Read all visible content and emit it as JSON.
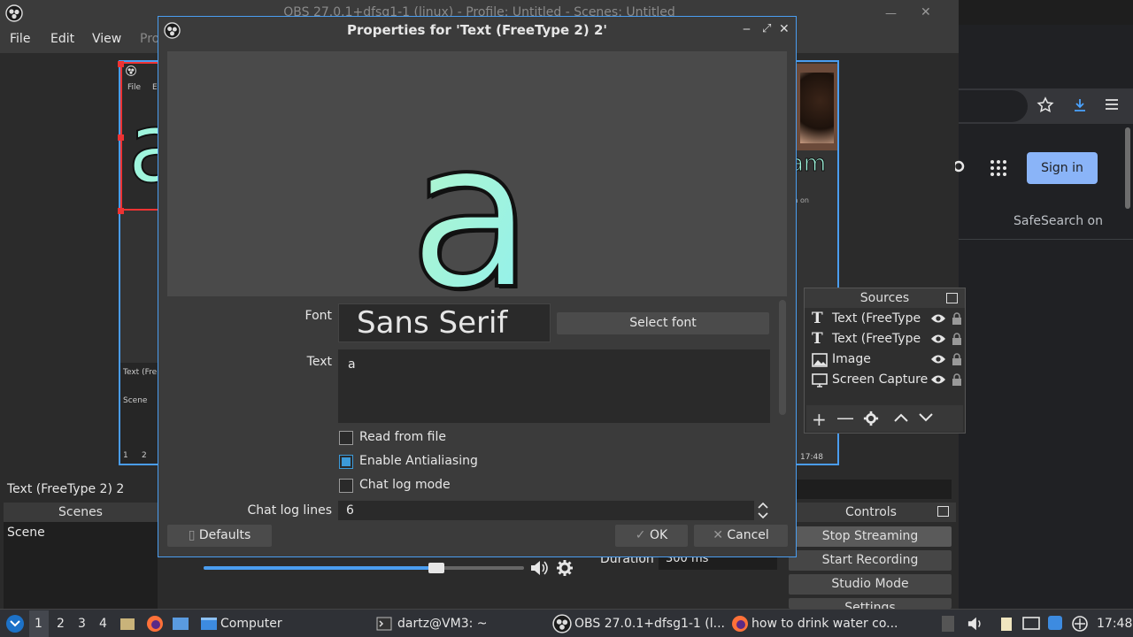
{
  "obs": {
    "window_title": "OBS 27.0.1+dfsg1-1 (linux) - Profile: Untitled - Scenes: Untitled",
    "menu": [
      "File",
      "Edit",
      "View",
      "Pro"
    ],
    "preview_mini": {
      "menu": [
        "File",
        "E"
      ],
      "text_label": "Text (Fre",
      "scene_label": "Scene",
      "taskbar": [
        "1",
        "2"
      ],
      "clock": "17:48",
      "caption": "ch on"
    },
    "selected_source_label": "Text (FreeType 2) 2",
    "scenes": {
      "title": "Scenes",
      "items": [
        "Scene"
      ]
    },
    "controls": {
      "title": "Controls",
      "buttons": [
        "Stop Streaming",
        "Start Recording",
        "Studio Mode",
        "Settings"
      ]
    },
    "transition": {
      "duration_label": "Duration",
      "duration_value": "300 ms"
    },
    "sources": {
      "title": "Sources",
      "items": [
        {
          "name": "Text (FreeType",
          "icon": "text-icon"
        },
        {
          "name": "Text (FreeType",
          "icon": "text-icon"
        },
        {
          "name": "Image",
          "icon": "image-icon"
        },
        {
          "name": "Screen Capture",
          "icon": "monitor-icon"
        }
      ]
    }
  },
  "browser": {
    "sign_in": "Sign in",
    "safesearch": "SafeSearch on"
  },
  "dialog": {
    "title": "Properties for 'Text (FreeType 2) 2'",
    "preview_text": "a",
    "font_label": "Font",
    "font_value": "Sans Serif",
    "select_font": "Select font",
    "text_label": "Text",
    "text_value": "a",
    "read_from_file": "Read from file",
    "enable_antialiasing": "Enable Antialiasing",
    "chat_log_mode": "Chat log mode",
    "chat_log_lines_label": "Chat log lines",
    "chat_log_lines_value": "6",
    "defaults": "Defaults",
    "ok": "OK",
    "cancel": "Cancel",
    "checks": {
      "read_from_file": false,
      "enable_antialiasing": true,
      "chat_log_mode": false
    }
  },
  "taskbar": {
    "workspaces": [
      "1",
      "2",
      "3",
      "4"
    ],
    "items": [
      "Computer",
      "dartz@VM3: ~",
      "OBS 27.0.1+dfsg1-1 (l...",
      "how to drink water co..."
    ],
    "clock": "17:48"
  },
  "colors": {
    "accent": "#4a9df0",
    "text_fill": "#9ff5dd"
  }
}
